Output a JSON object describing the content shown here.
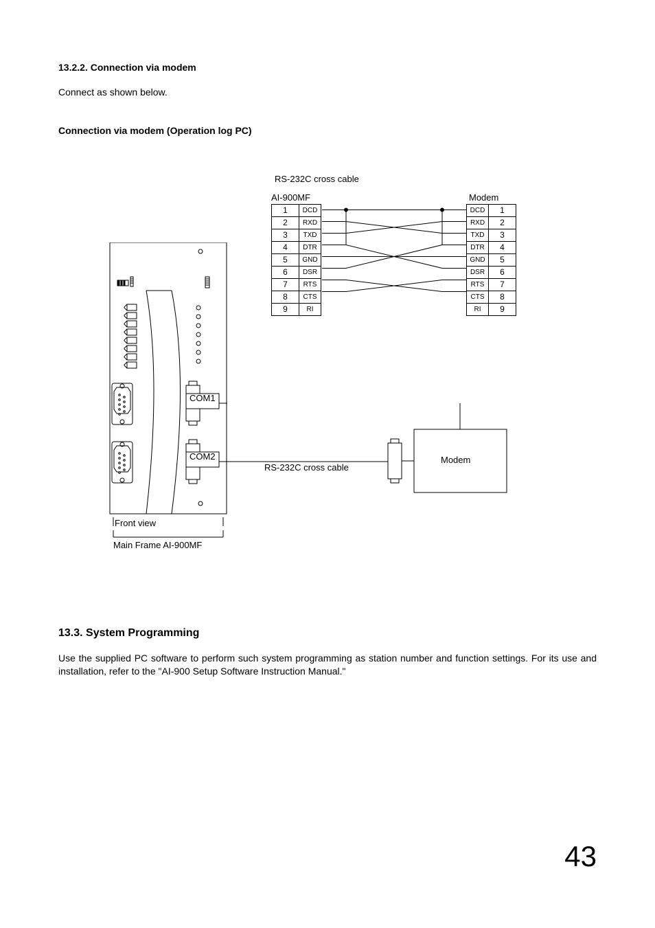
{
  "heading_1322": "13.2.2. Connection via modem",
  "intro_para": "Connect as shown below.",
  "heading_oplog": "Connection via modem (Operation log PC)",
  "cable_title": "RS-232C cross cable",
  "pin_header_left": "AI-900MF",
  "pin_header_right": "Modem",
  "pins_left": [
    {
      "n": "1",
      "s": "DCD"
    },
    {
      "n": "2",
      "s": "RXD"
    },
    {
      "n": "3",
      "s": "TXD"
    },
    {
      "n": "4",
      "s": "DTR"
    },
    {
      "n": "5",
      "s": "GND"
    },
    {
      "n": "6",
      "s": "DSR"
    },
    {
      "n": "7",
      "s": "RTS"
    },
    {
      "n": "8",
      "s": "CTS"
    },
    {
      "n": "9",
      "s": "RI"
    }
  ],
  "pins_right": [
    {
      "s": "DCD",
      "n": "1"
    },
    {
      "s": "RXD",
      "n": "2"
    },
    {
      "s": "TXD",
      "n": "3"
    },
    {
      "s": "DTR",
      "n": "4"
    },
    {
      "s": "GND",
      "n": "5"
    },
    {
      "s": "DSR",
      "n": "6"
    },
    {
      "s": "RTS",
      "n": "7"
    },
    {
      "s": "CTS",
      "n": "8"
    },
    {
      "s": "RI",
      "n": "9"
    }
  ],
  "com1_label": "COM1",
  "com2_label": "COM2",
  "cable_label_lower": "RS-232C cross cable",
  "modem_box_label": "Modem",
  "front_view_label": "Front view",
  "main_frame_label": "Main Frame AI-900MF",
  "heading_133": "13.3. System Programming",
  "para_133": "Use the supplied PC software to perform such system programming as station number and function settings. For its use and installation, refer to the \"AI-900 Setup Software Instruction Manual.\"",
  "page_number": "43"
}
